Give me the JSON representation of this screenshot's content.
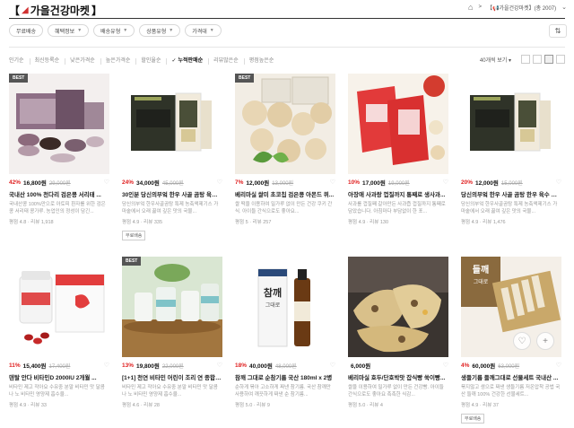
{
  "header": {
    "title": "가을건강마켓",
    "breadcrumb": "【📢가을건강마켓】(총 2007)"
  },
  "filters": [
    {
      "label": "무료배송",
      "dropdown": false
    },
    {
      "label": "혜택정보",
      "dropdown": true
    },
    {
      "label": "배송유형",
      "dropdown": true
    },
    {
      "label": "상품유형",
      "dropdown": true
    },
    {
      "label": "가격대",
      "dropdown": true
    }
  ],
  "sort_options": [
    "인기순",
    "최신등록순",
    "낮은가격순",
    "높은가격순",
    "할인율순",
    "누적판매순",
    "리뷰많은순",
    "평점높은순"
  ],
  "active_sort": "누적판매순",
  "per_page": "40개씩 보기",
  "products": [
    {
      "best": true,
      "discount": "42%",
      "price": "16,800원",
      "original": "29,000원",
      "name": "국내산 100% 천다리 검은콩 서리태 ...",
      "desc": "국내산콩 100%만으로 아토피 환자를 위한 검은콩 서리태 콩가루. 농업인의 정성이 담긴...",
      "rating": "평점 4.8 · 리뷰 1,918",
      "tag": ""
    },
    {
      "best": false,
      "discount": "24%",
      "price": "34,000원",
      "original": "45,000원",
      "name": "30인분 당신의부엌 한우 사골 곰탕 육수 ...",
      "desc": "당신의부엌 한우사골곰탕 특제 농축액제기스 가마솥에서 오래 끓여 깊은 맛의 국물...",
      "rating": "평점 4.9 · 리뷰 335",
      "tag": "무료배송"
    },
    {
      "best": true,
      "discount": "7%",
      "price": "12,000원",
      "original": "13,000원",
      "name": "베리마실 쌀미 초코칩 검은콩 아몬드 퀴...",
      "desc": "쌀 떡을 이용하여 밀가루 없이 만든 건강 쿠키 간식. 아이들 간식으로도 좋아요...",
      "rating": "평점 5 · 리뷰 257",
      "tag": ""
    },
    {
      "best": false,
      "discount": "10%",
      "price": "17,000원",
      "original": "19,000원",
      "name": "아장애 사과랑 껍질까지 통째로 생사과...",
      "desc": "사과를 껍질째 갈아만든 사과즙 껍질까지 통째로 담았습니다. 아침마다 부담없이 한 포...",
      "rating": "평점 4.9 · 리뷰 130",
      "tag": ""
    },
    {
      "best": false,
      "discount": "20%",
      "price": "12,000원",
      "original": "15,000원",
      "name": "당신의부엌 한우 사골 곰탕 한우 육수 곰 아침...",
      "desc": "당신의부엌 한우사골곰탕 특제 농축액제기스 가마솥에서 오래 끓여 깊은 맛의 국물...",
      "rating": "평점 4.9 · 리뷰 1,476",
      "tag": ""
    },
    {
      "best": false,
      "discount": "11%",
      "price": "15,400원",
      "original": "17,400원",
      "name": "덴탈 안다 비타민D 2000IU 2개월 ...",
      "desc": "비타민 제고 작아요 수유중 분말 비타민 맛 달콤 나 노 비타민 영양제 흡수율...",
      "rating": "평점 4.9 · 리뷰 33",
      "tag": ""
    },
    {
      "best": true,
      "discount": "13%",
      "price": "19,800원",
      "original": "22,000원",
      "name": "[1+1] 천연 비타민 어린이 조리 연 종합비타민...",
      "desc": "비타민 제고 작아요 수유중 분말 비타민 맛 달콤 나 노 비타민 영양제 흡수율...",
      "rating": "평점 4.6 · 리뷰 28",
      "tag": ""
    },
    {
      "best": false,
      "discount": "18%",
      "price": "40,000원",
      "original": "48,000원",
      "name": "참깨 그대로 순참기름 국산 180ml x 2병",
      "desc": "순하게 볶아 고소하게 짜낸 참기름. 국산 참깨만 사용하여 깨끗하게 짜낸 순 참기름...",
      "rating": "평점 5.0 · 리뷰 9",
      "tag": ""
    },
    {
      "best": false,
      "discount": "",
      "price": "6,000원",
      "original": "",
      "name": "베리마실 호두/단호박맛 잡식빵 쑥이빵...",
      "desc": "쌀을 이용하여 밀가루 없이 만든 건강빵. 아이들 간식으로도 좋아요 촉촉한 식감...",
      "rating": "평점 5.0 · 리뷰 4",
      "tag": ""
    },
    {
      "best": false,
      "discount": "4%",
      "price": "60,000원",
      "original": "63,000원",
      "name": "생들기름 들깨그대로 선물세트 국내산 ...",
      "desc": "볶지않고 생으로 짜낸 생들기름 저온압착 공법 국산 들깨 100% 건강한 선물세트...",
      "rating": "평점 4.9 · 리뷰 37",
      "tag": "무료배송"
    }
  ]
}
